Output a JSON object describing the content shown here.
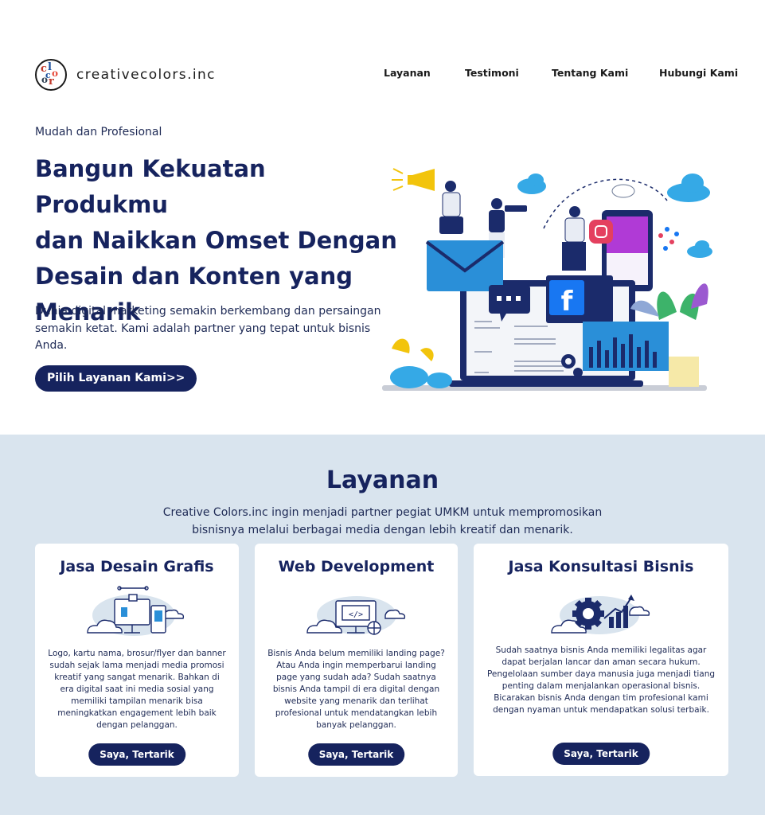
{
  "brand": {
    "name": "creativecolors.inc"
  },
  "nav": {
    "items": [
      "Layanan",
      "Testimoni",
      "Tentang Kami",
      "Hubungi Kami"
    ]
  },
  "hero": {
    "eyebrow": "Mudah dan Profesional",
    "title_lines": [
      "Bangun Kekuatan Produkmu",
      "dan Naikkan Omset Dengan",
      "Desain dan Konten yang",
      "Menarik"
    ],
    "description": "Dunia digital marketing semakin berkembang dan persaingan semakin ketat. Kami adalah partner yang tepat untuk bisnis Anda.",
    "cta_label": "Pilih Layanan Kami>>"
  },
  "services": {
    "title": "Layanan",
    "description_lines": [
      "Creative Colors.inc ingin menjadi partner pegiat UMKM untuk mempromosikan",
      "bisnisnya melalui berbagai media dengan lebih kreatif dan menarik."
    ],
    "cards": [
      {
        "title": "Jasa Desain Grafis",
        "icon": "design-tools-icon",
        "text": "Logo, kartu nama, brosur/flyer dan banner sudah sejak lama menjadi media promosi kreatif yang sangat menarik. Bahkan di era digital saat ini media sosial yang memiliki tampilan menarik bisa meningkatkan engagement lebih baik dengan pelanggan.",
        "button": "Saya, Tertarik"
      },
      {
        "title": "Web Development",
        "icon": "code-monitor-icon",
        "text": "Bisnis Anda belum memiliki landing page? Atau Anda ingin memperbarui landing page yang sudah ada? Sudah saatnya bisnis Anda tampil di era digital dengan website yang menarik dan terlihat profesional untuk mendatangkan lebih banyak pelanggan.",
        "button": "Saya, Tertarik"
      },
      {
        "title": "Jasa Konsultasi Bisnis",
        "icon": "gear-chart-icon",
        "text": "Sudah saatnya bisnis Anda memiliki legalitas agar dapat berjalan lancar dan aman secara hukum. Pengelolaan sumber daya manusia juga menjadi tiang penting dalam menjalankan operasional bisnis. Bicarakan bisnis Anda dengan tim profesional kami dengan nyaman untuk mendapatkan solusi terbaik.",
        "button": "Saya, Tertarik"
      }
    ]
  },
  "colors": {
    "navy": "#16235e",
    "services_bg": "#d9e4ee",
    "accent_blue": "#2aa8e0"
  }
}
